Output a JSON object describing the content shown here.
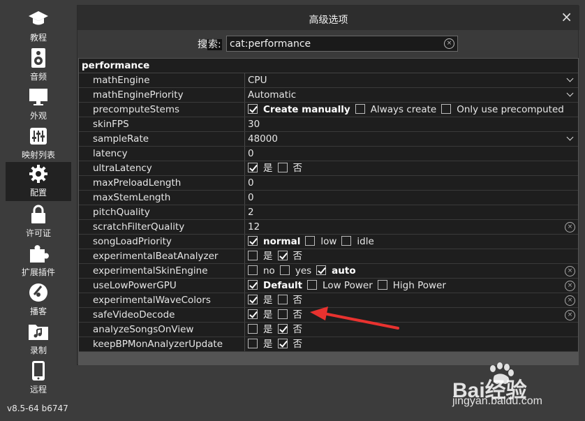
{
  "sidebar": {
    "items": [
      {
        "label": "教程",
        "icon": "graduation-cap-icon"
      },
      {
        "label": "音频",
        "icon": "speaker-icon"
      },
      {
        "label": "外观",
        "icon": "monitor-icon"
      },
      {
        "label": "映射列表",
        "icon": "sliders-icon"
      },
      {
        "label": "配置",
        "icon": "gear-icon",
        "active": true
      },
      {
        "label": "许可证",
        "icon": "lock-icon"
      },
      {
        "label": "扩展插件",
        "icon": "puzzle-icon"
      },
      {
        "label": "播客",
        "icon": "podcast-icon"
      },
      {
        "label": "录制",
        "icon": "music-folder-icon"
      },
      {
        "label": "远程",
        "icon": "phone-icon"
      }
    ],
    "version": "v8.5-64 b6747"
  },
  "dialog": {
    "title": "高级选项",
    "close": "×",
    "search_label_a": "搜",
    "search_label_b": "索:",
    "search_value": "cat:performance",
    "clear": "×"
  },
  "table": {
    "section": "performance",
    "rows": [
      {
        "name": "mathEngine",
        "value": "CPU",
        "select": true
      },
      {
        "name": "mathEnginePriority",
        "value": "Automatic",
        "select": true
      },
      {
        "name": "precomputeStems",
        "options": [
          {
            "label": "Create manually",
            "checked": true,
            "bold": true
          },
          {
            "label": "Always create",
            "checked": false
          },
          {
            "label": "Only use precomputed",
            "checked": false
          }
        ]
      },
      {
        "name": "skinFPS",
        "value": "30"
      },
      {
        "name": "sampleRate",
        "value": "48000",
        "select": true
      },
      {
        "name": "latency",
        "value": "0"
      },
      {
        "name": "ultraLatency",
        "options": [
          {
            "label": "是",
            "checked": true
          },
          {
            "label": "否",
            "checked": false
          }
        ]
      },
      {
        "name": "maxPreloadLength",
        "value": "0"
      },
      {
        "name": "maxStemLength",
        "value": "0"
      },
      {
        "name": "pitchQuality",
        "value": "2"
      },
      {
        "name": "scratchFilterQuality",
        "value": "12",
        "clear": true
      },
      {
        "name": "songLoadPriority",
        "options": [
          {
            "label": "normal",
            "checked": true,
            "bold": true
          },
          {
            "label": "low",
            "checked": false
          },
          {
            "label": "idle",
            "checked": false
          }
        ]
      },
      {
        "name": "experimentalBeatAnalyzer",
        "options": [
          {
            "label": "是",
            "checked": false
          },
          {
            "label": "否",
            "checked": true
          }
        ]
      },
      {
        "name": "experimentalSkinEngine",
        "options": [
          {
            "label": "no",
            "checked": false
          },
          {
            "label": "yes",
            "checked": false
          },
          {
            "label": "auto",
            "checked": true,
            "bold": true
          }
        ],
        "clear": true
      },
      {
        "name": "useLowPowerGPU",
        "options": [
          {
            "label": "Default",
            "checked": true,
            "bold": true
          },
          {
            "label": "Low Power",
            "checked": false
          },
          {
            "label": "High Power",
            "checked": false
          }
        ],
        "clear": true
      },
      {
        "name": "experimentalWaveColors",
        "options": [
          {
            "label": "是",
            "checked": true
          },
          {
            "label": "否",
            "checked": false
          }
        ],
        "clear": true
      },
      {
        "name": "safeVideoDecode",
        "options": [
          {
            "label": "是",
            "checked": true
          },
          {
            "label": "否",
            "checked": false
          }
        ],
        "clear": true
      },
      {
        "name": "analyzeSongsOnView",
        "options": [
          {
            "label": "是",
            "checked": false
          },
          {
            "label": "否",
            "checked": true
          }
        ]
      },
      {
        "name": "keepBPMonAnalyzerUpdate",
        "options": [
          {
            "label": "是",
            "checked": false
          },
          {
            "label": "否",
            "checked": true
          }
        ]
      }
    ]
  },
  "watermark": {
    "brand": "Bai经验",
    "url": "jingyan.baidu.com"
  },
  "colors": {
    "annotation_arrow": "#e8322f"
  }
}
